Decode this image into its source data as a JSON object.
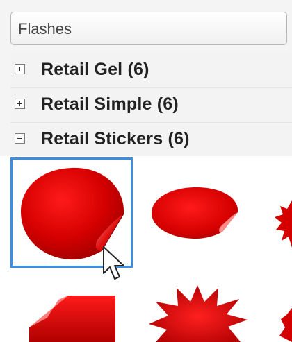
{
  "dropdown": {
    "value": "Flashes"
  },
  "categories": [
    {
      "label": "Retail Gel (6)",
      "expanded": false
    },
    {
      "label": "Retail Simple (6)",
      "expanded": false
    },
    {
      "label": "Retail Stickers (6)",
      "expanded": true
    }
  ],
  "colors": {
    "sticker_red": "#d40000",
    "selection_border": "#3b8ee0"
  },
  "icons": {
    "expand": "plus-box-icon",
    "collapse": "minus-box-icon",
    "pointer": "arrow-cursor-icon"
  }
}
